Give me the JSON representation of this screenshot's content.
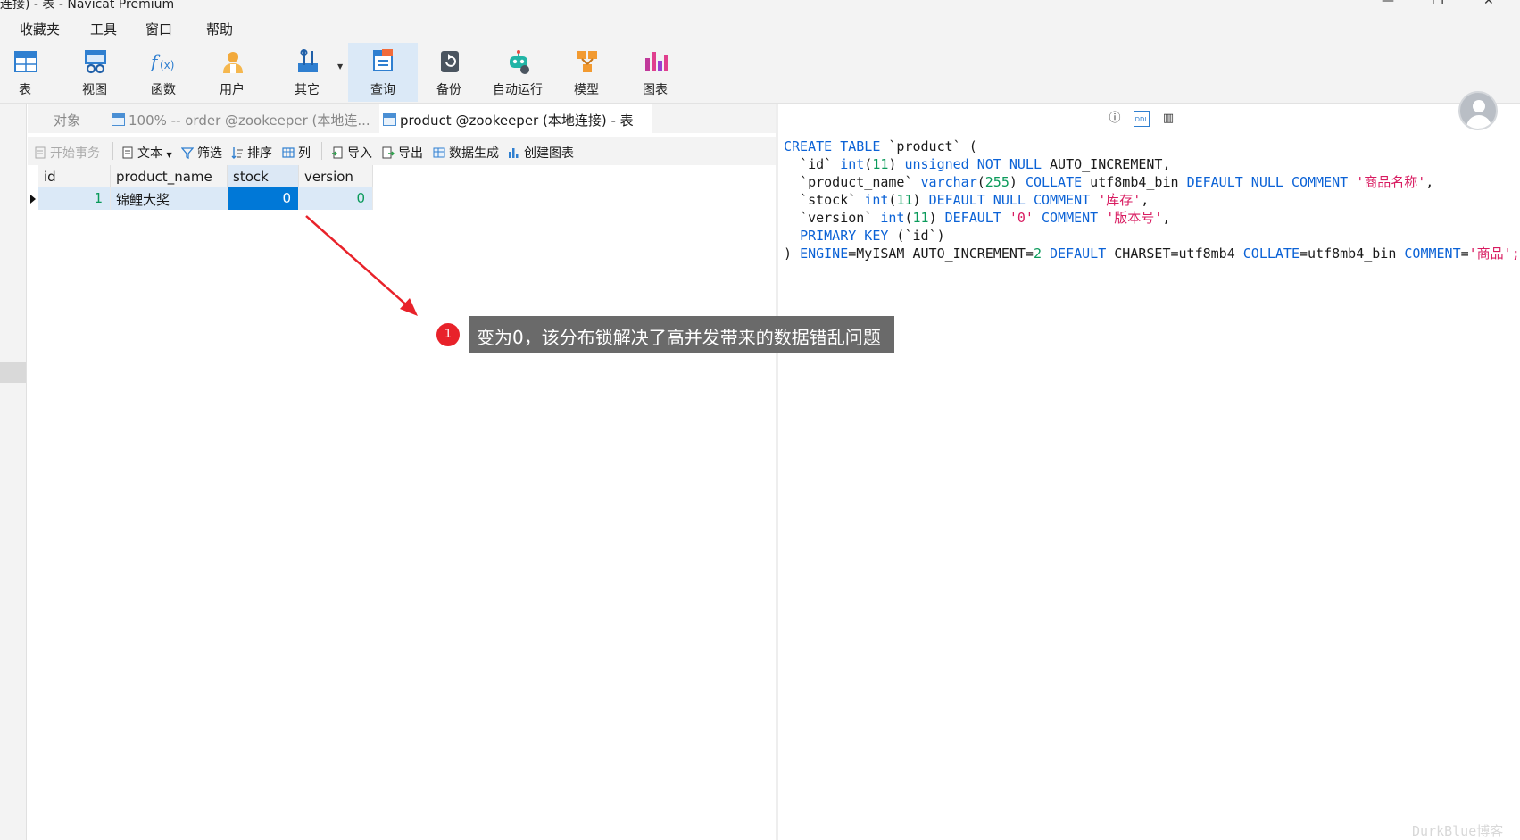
{
  "window": {
    "title": "连接) - 表 - Navicat Premium"
  },
  "menu": [
    "收藏夹",
    "工具",
    "窗口",
    "帮助"
  ],
  "toolbar": {
    "buttons": [
      {
        "label": "表",
        "icon": "table-icon"
      },
      {
        "label": "视图",
        "icon": "view-icon"
      },
      {
        "label": "函数",
        "icon": "function-icon"
      },
      {
        "label": "用户",
        "icon": "user-icon"
      },
      {
        "label": "其它",
        "icon": "tools-icon"
      },
      {
        "label": "查询",
        "icon": "query-icon",
        "active": true
      },
      {
        "label": "备份",
        "icon": "backup-icon"
      },
      {
        "label": "自动运行",
        "icon": "robot-icon"
      },
      {
        "label": "模型",
        "icon": "model-icon"
      },
      {
        "label": "图表",
        "icon": "chart-icon"
      }
    ]
  },
  "tabs": [
    {
      "label": "对象"
    },
    {
      "label": "100% -- order @zookeeper (本地连..."
    },
    {
      "label": "product @zookeeper (本地连接) - 表",
      "active": true
    }
  ],
  "grid_toolbar": {
    "begin_transaction": "开始事务",
    "text": "文本",
    "filter": "筛选",
    "sort": "排序",
    "columns": "列",
    "import": "导入",
    "export": "导出",
    "data_generation": "数据生成",
    "create_chart": "创建图表"
  },
  "table": {
    "columns": [
      "id",
      "product_name",
      "stock",
      "version"
    ],
    "rows": [
      {
        "id": "1",
        "product_name": "锦鲤大奖",
        "stock": "0",
        "version": "0"
      }
    ]
  },
  "ddl": {
    "l1_a": "CREATE TABLE",
    "l1_b": " `product` (",
    "l2_a": "  `id` ",
    "l2_b": "int",
    "l2_c": "(",
    "l2_d": "11",
    "l2_e": ") ",
    "l2_f": "unsigned NOT NULL",
    "l2_g": " AUTO_INCREMENT,",
    "l3_a": "  `product_name` ",
    "l3_b": "varchar",
    "l3_c": "(",
    "l3_d": "255",
    "l3_e": ") ",
    "l3_f": "COLLATE",
    "l3_g": " utf8mb4_bin ",
    "l3_h": "DEFAULT NULL COMMENT",
    "l3_i": " ",
    "l3_j": "'商品名称'",
    "l3_k": ",",
    "l4_a": "  `stock` ",
    "l4_b": "int",
    "l4_c": "(",
    "l4_d": "11",
    "l4_e": ") ",
    "l4_f": "DEFAULT NULL COMMENT",
    "l4_g": " ",
    "l4_h": "'库存'",
    "l4_i": ",",
    "l5_a": "  `version` ",
    "l5_b": "int",
    "l5_c": "(",
    "l5_d": "11",
    "l5_e": ") ",
    "l5_f": "DEFAULT",
    "l5_g": " ",
    "l5_h": "'0'",
    "l5_i": " ",
    "l5_j": "COMMENT",
    "l5_k": " ",
    "l5_l": "'版本号'",
    "l5_m": ",",
    "l6_a": "  ",
    "l6_b": "PRIMARY KEY",
    "l6_c": " (`id`)",
    "l7_a": ") ",
    "l7_b": "ENGINE",
    "l7_c": "=MyISAM AUTO_INCREMENT=",
    "l7_d": "2",
    "l7_e": " ",
    "l7_f": "DEFAULT",
    "l7_g": " CHARSET=utf8mb4 ",
    "l7_h": "COLLATE",
    "l7_i": "=utf8mb4_bin ",
    "l7_j": "COMMENT",
    "l7_k": "=",
    "l7_l": "'商品';"
  },
  "annotation": {
    "number": "1",
    "text": "变为0，该分布锁解决了高并发带来的数据错乱问题"
  },
  "watermark": "DurkBlue博客",
  "colors": {
    "keyword": "#0b62d6",
    "number": "#0a9a5a",
    "string": "#d81b60",
    "selection": "#0078d7",
    "row_highlight": "#dbe9f7"
  }
}
